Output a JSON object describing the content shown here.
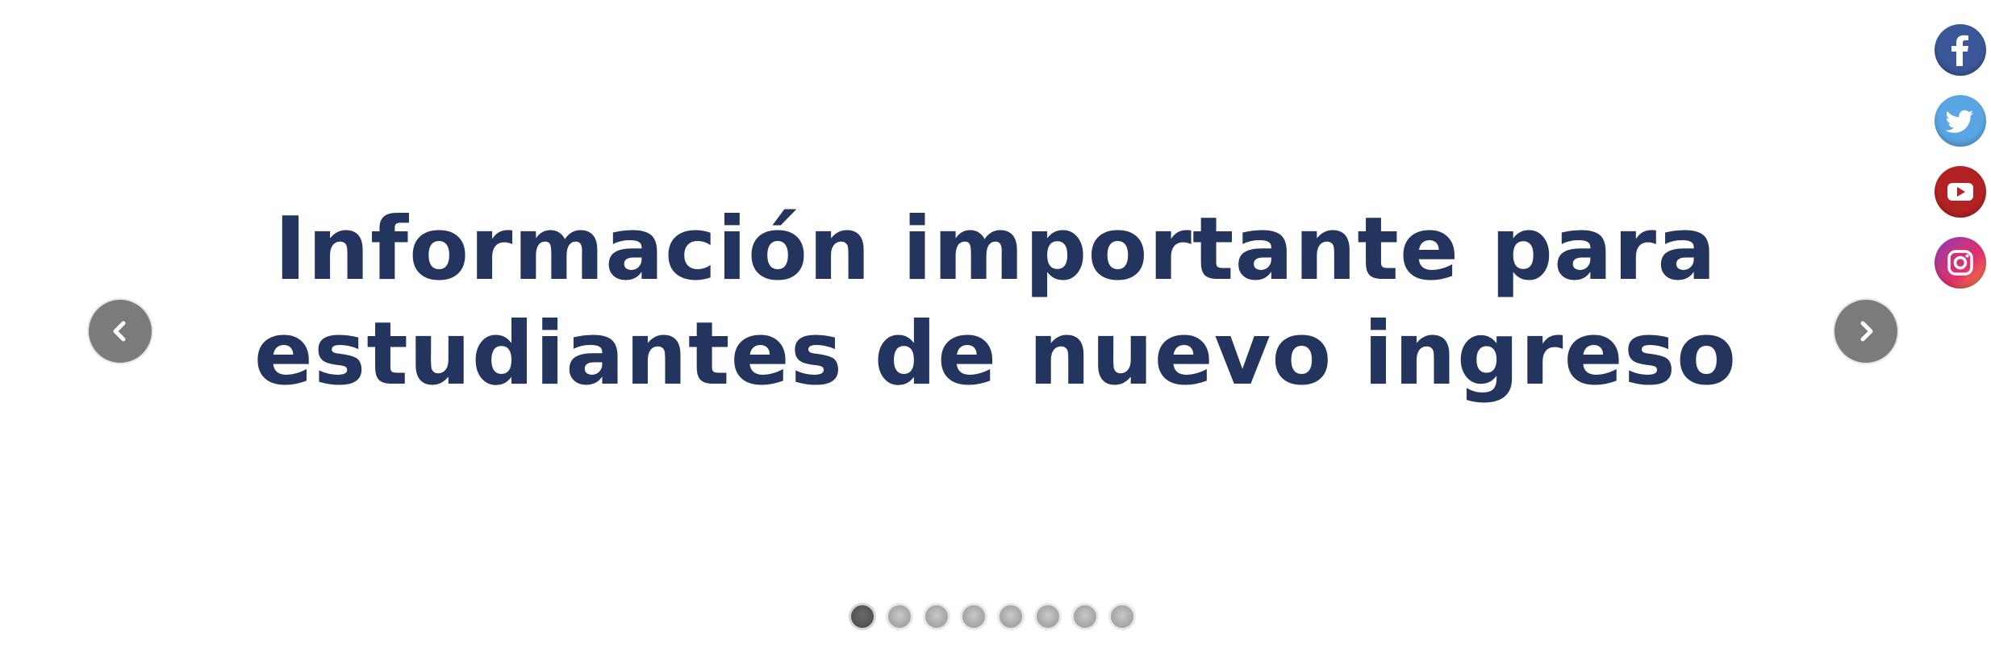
{
  "slider": {
    "headline_line1": "Información importante para",
    "headline_line2": "estudiantes de nuevo ingreso",
    "prev_icon": "chevron-left-icon",
    "next_icon": "chevron-right-icon",
    "dots_count": 8,
    "active_dot": 1
  },
  "social": {
    "items": [
      {
        "name": "facebook",
        "icon": "facebook-icon",
        "color": "#3b5799"
      },
      {
        "name": "twitter",
        "icon": "twitter-icon",
        "color": "#5aa5e3"
      },
      {
        "name": "youtube",
        "icon": "youtube-icon",
        "color": "#b22222"
      },
      {
        "name": "instagram",
        "icon": "instagram-icon",
        "color": "#c13584"
      }
    ]
  },
  "colors": {
    "headline": "#23345f",
    "arrow_bg": "#7b7b7b"
  }
}
